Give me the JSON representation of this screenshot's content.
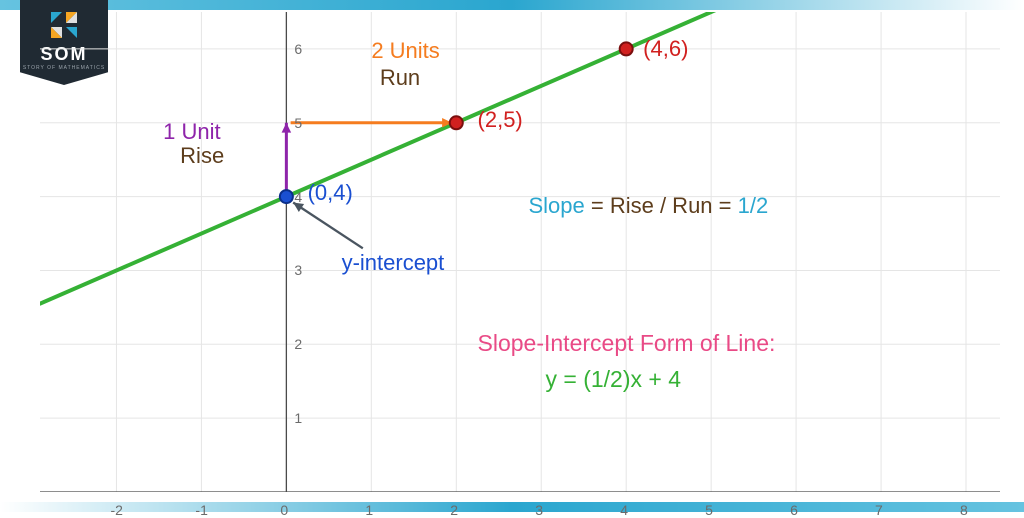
{
  "logo": {
    "title": "SOM",
    "subtitle": "STORY OF MATHEMATICS"
  },
  "axis": {
    "x_ticks": [
      -2,
      -1,
      0,
      1,
      2,
      3,
      4,
      5,
      6,
      7,
      8
    ],
    "y_ticks": [
      1,
      2,
      3,
      4,
      5,
      6
    ],
    "x_min": -2.9,
    "x_max": 8.4,
    "y_min": 0,
    "y_max": 6.5
  },
  "rise_label_value": "1 Unit",
  "rise_label_word": "Rise",
  "run_label_value": "2 Units",
  "run_label_word": "Run",
  "yint_label": "y-intercept",
  "slope_word": "Slope",
  "eq_mid": " = Rise / Run = ",
  "slope_value": "1/2",
  "form_title": "Slope-Intercept Form of Line:",
  "equation": "y = (1/2)x + 4",
  "pts": {
    "p0": "(0,4)",
    "p1": "(2,5)",
    "p2": "(4,6)"
  },
  "colors": {
    "line": "#35b135",
    "orange": "#f57c1f",
    "red": "#d1201f",
    "purple": "#8e24aa",
    "brown": "#5d3d1c",
    "blue": "#1a4fd1",
    "sky": "#2aa6cf",
    "slate": "#4a5560",
    "pink": "#e94a86"
  },
  "chart_data": {
    "type": "line",
    "title": "Slope-Intercept Form of Line",
    "xlabel": "",
    "ylabel": "",
    "x": [
      -2.9,
      8.4
    ],
    "y": [
      2.55,
      8.2
    ],
    "xlim": [
      -2.9,
      8.4
    ],
    "ylim": [
      0,
      6.5
    ],
    "points": [
      {
        "x": 0,
        "y": 4,
        "label": "(0,4)",
        "role": "y-intercept"
      },
      {
        "x": 2,
        "y": 5,
        "label": "(2,5)"
      },
      {
        "x": 4,
        "y": 6,
        "label": "(4,6)"
      }
    ],
    "rise": 1,
    "run": 2,
    "slope": 0.5,
    "intercept": 4,
    "equation": "y = (1/2)x + 4",
    "x_ticks": [
      -2,
      -1,
      0,
      1,
      2,
      3,
      4,
      5,
      6,
      7,
      8
    ],
    "y_ticks": [
      1,
      2,
      3,
      4,
      5,
      6
    ]
  }
}
